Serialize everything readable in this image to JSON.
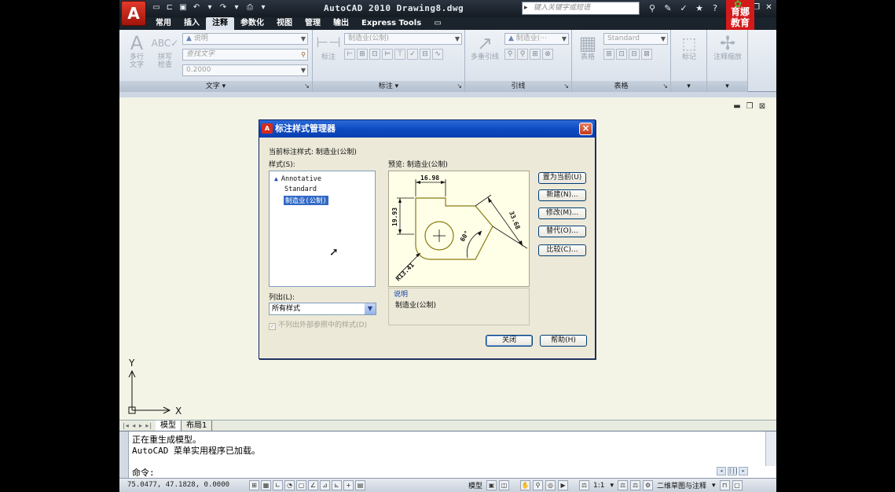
{
  "titlebar": {
    "app_logo": "A",
    "title": "AutoCAD 2010  Drawing8.dwg",
    "search_placeholder": "键入关键字或短语",
    "brand_line1": "育娜",
    "brand_line2": "教育"
  },
  "tabs": [
    {
      "label": "常用"
    },
    {
      "label": "插入"
    },
    {
      "label": "注释",
      "active": true
    },
    {
      "label": "参数化"
    },
    {
      "label": "视图"
    },
    {
      "label": "管理"
    },
    {
      "label": "输出"
    },
    {
      "label": "Express Tools"
    }
  ],
  "ribbon": {
    "text_panel": {
      "title": "文字",
      "multiline_text": "多行\n文字",
      "spell_check": "拼写\n检查",
      "text_style": "说明",
      "find_text_placeholder": "查找文字",
      "text_height": "0.2000"
    },
    "dim_panel": {
      "title": "标注",
      "dimension": "标注",
      "dim_style": "制造业(公制)"
    },
    "leader_panel": {
      "title": "引线",
      "multileader": "多重引线",
      "mleader_style": "制造业(···"
    },
    "table_panel": {
      "title": "表格",
      "table": "表格",
      "table_style": "Standard"
    },
    "markup_panel": {
      "label": "标记"
    },
    "scale_panel": {
      "label": "注释缩放"
    }
  },
  "dialog": {
    "title": "标注样式管理器",
    "current_style_label": "当前标注样式: 制造业(公制)",
    "styles_label": "样式(S):",
    "styles": [
      {
        "name": "Annotative",
        "annotative": true
      },
      {
        "name": "Standard"
      },
      {
        "name": "制造业(公制)",
        "selected": true
      }
    ],
    "preview_label": "预览: 制造业(公制)",
    "preview_dims": {
      "top": "16.98",
      "left": "19.93",
      "slant": "33.68",
      "angle": "60°",
      "radius": "R13.41"
    },
    "list_label": "列出(L):",
    "list_value": "所有样式",
    "exclude_xref": "不列出外部参照中的样式(D)",
    "description_header": "说明",
    "description_value": "制造业(公制)",
    "buttons": {
      "set_current": "置为当前(U)",
      "new": "新建(N)...",
      "modify": "修改(M)...",
      "override": "替代(O)...",
      "compare": "比较(C)...",
      "close": "关闭",
      "help": "帮助(H)"
    }
  },
  "layout_tabs": [
    {
      "label": "模型",
      "active": true
    },
    {
      "label": "布局1"
    }
  ],
  "command": {
    "line1": "正在重生成模型。",
    "line2": "AutoCAD 菜单实用程序已加载。",
    "prompt": "命令:"
  },
  "statusbar": {
    "coords": "75.0477, 47.1828, 0.0000",
    "model": "模型",
    "scale": "1:1",
    "workspace": "二维草图与注释"
  }
}
